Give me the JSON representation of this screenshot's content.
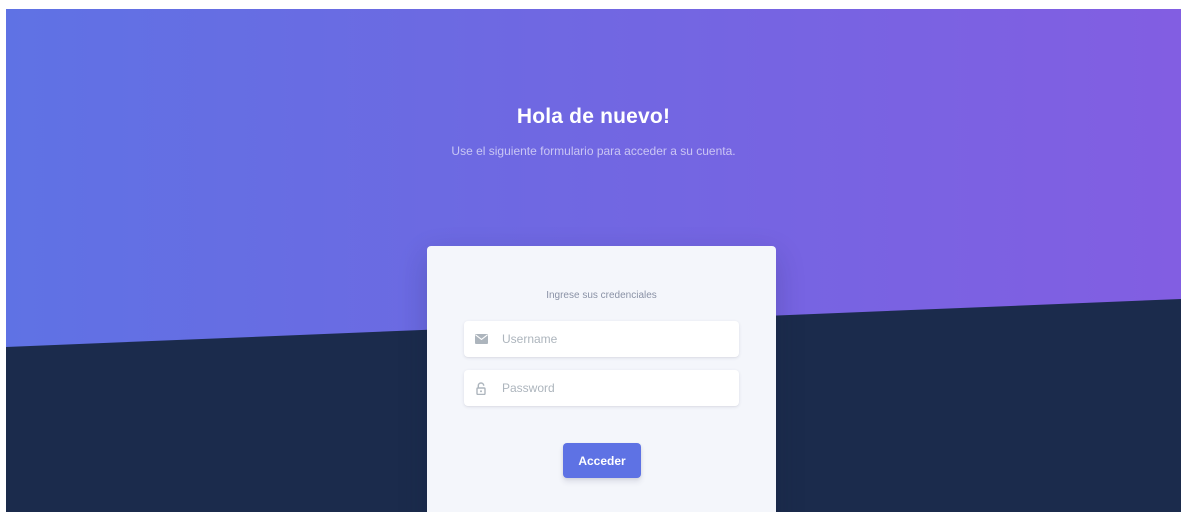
{
  "hero": {
    "title": "Hola de nuevo!",
    "subtitle": "Use el siguiente formulario para acceder a su cuenta."
  },
  "login_card": {
    "heading": "Ingrese sus credenciales",
    "username": {
      "icon": "envelope-icon",
      "value": "",
      "placeholder": "Username"
    },
    "password": {
      "icon": "lock-icon",
      "value": "",
      "placeholder": "Password"
    },
    "submit_label": "Acceder"
  },
  "colors": {
    "gradient_start": "#5f72e4",
    "gradient_end": "#825ee2",
    "dark_band": "#1b2b4c",
    "card_background": "#f4f6fb",
    "primary_button": "#5e72e4",
    "icon_gray": "#adb5bd"
  }
}
